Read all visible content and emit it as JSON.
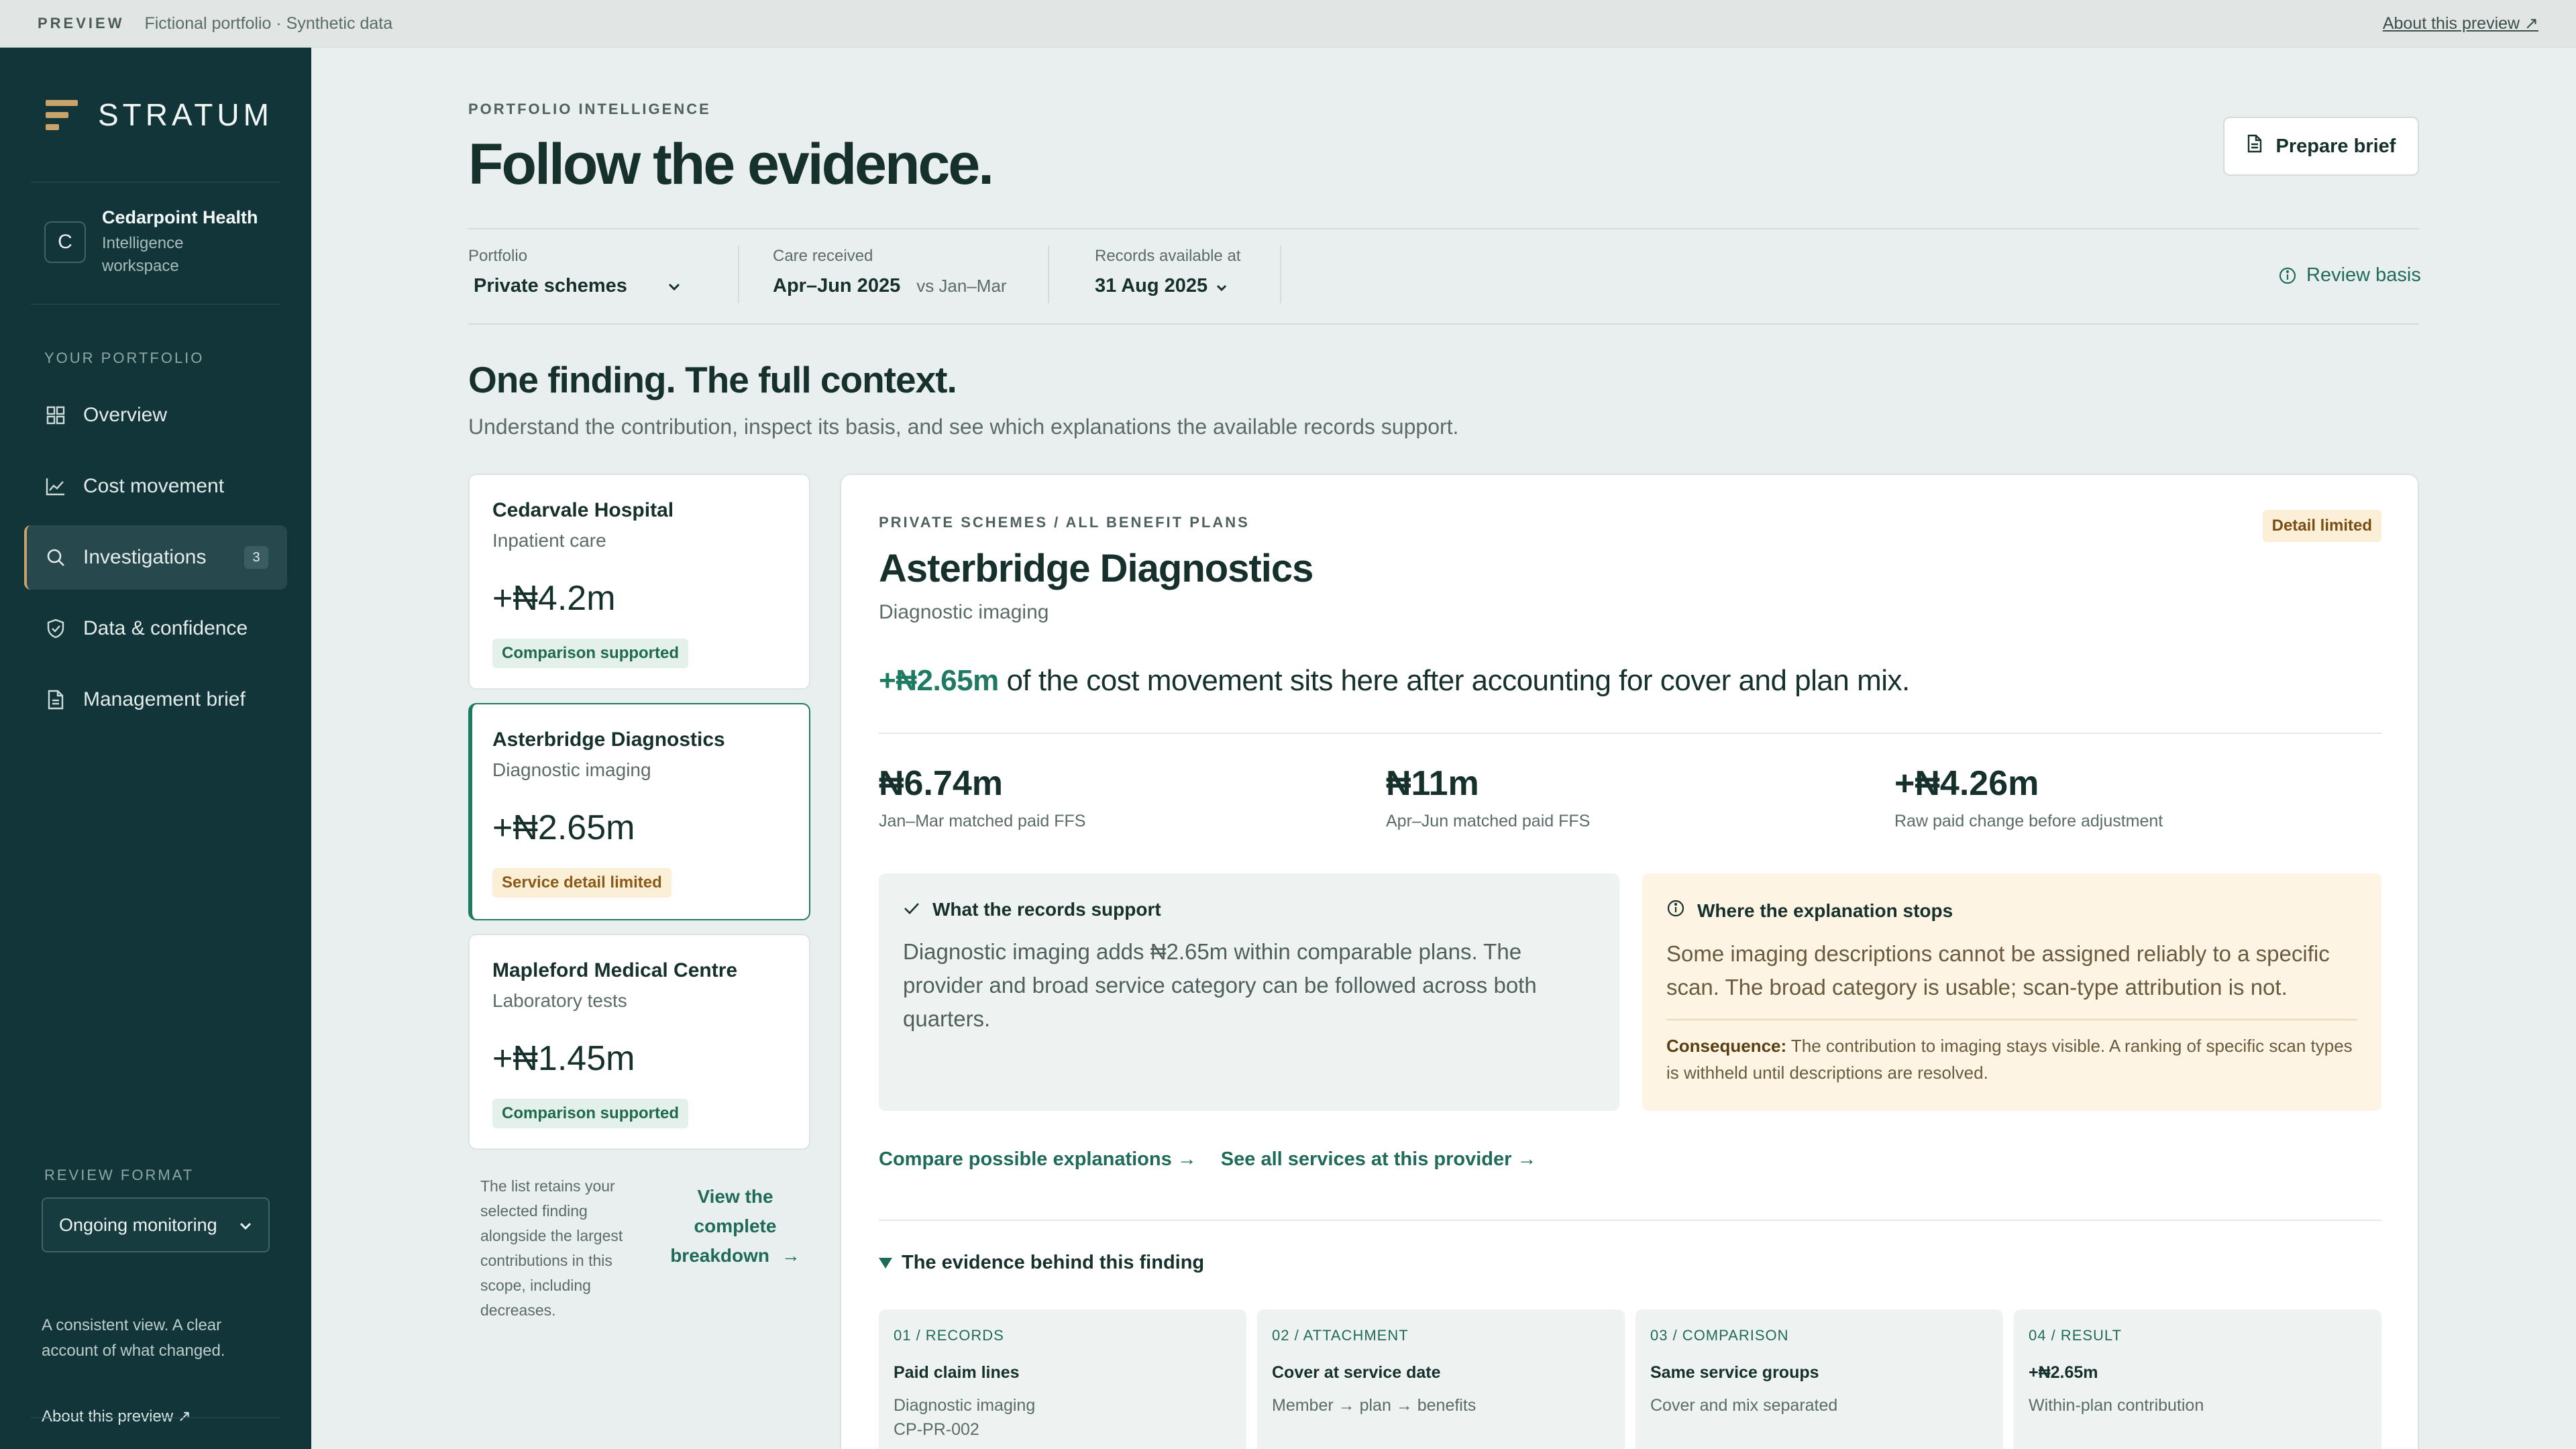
{
  "preview_bar": {
    "tag": "PREVIEW",
    "text": "Fictional portfolio · Synthetic data",
    "about_link": "About this preview ↗"
  },
  "sidebar": {
    "brand": "STRATUM",
    "org": {
      "initial": "C",
      "name": "Cedarpoint Health",
      "subtitle_line1": "Intelligence",
      "subtitle_line2": "workspace"
    },
    "section_label": "YOUR PORTFOLIO",
    "nav": [
      {
        "label": "Overview",
        "icon": "grid-icon"
      },
      {
        "label": "Cost movement",
        "icon": "line-chart-icon"
      },
      {
        "label": "Investigations",
        "icon": "search-icon",
        "badge": "3",
        "active": true
      },
      {
        "label": "Data & confidence",
        "icon": "shield-check-icon"
      },
      {
        "label": "Management brief",
        "icon": "document-icon"
      }
    ],
    "review_format_label": "REVIEW FORMAT",
    "review_format_value": "Ongoing monitoring",
    "note": "A consistent view. A clear account of what changed.",
    "about": "About this preview ↗"
  },
  "header": {
    "eyebrow": "PORTFOLIO INTELLIGENCE",
    "title": "Follow the evidence.",
    "prepare_button": "Prepare brief"
  },
  "filters": {
    "portfolio": {
      "label": "Portfolio",
      "value": "Private schemes"
    },
    "care": {
      "label": "Care received",
      "value": "Apr–Jun 2025",
      "compare": "vs Jan–Mar"
    },
    "records": {
      "label": "Records available at",
      "value": "31 Aug 2025"
    },
    "review_basis": "Review basis"
  },
  "section": {
    "title": "One finding. The full context.",
    "lead": "Understand the contribution, inspect its basis, and see which explanations the available records support."
  },
  "findings": [
    {
      "provider": "Cedarvale Hospital",
      "category": "Inpatient care",
      "amount": "+₦4.2m",
      "status": "Comparison supported",
      "tone": "green"
    },
    {
      "provider": "Asterbridge Diagnostics",
      "category": "Diagnostic imaging",
      "amount": "+₦2.65m",
      "status": "Service detail limited",
      "tone": "amber",
      "selected": true
    },
    {
      "provider": "Mapleford Medical Centre",
      "category": "Laboratory tests",
      "amount": "+₦1.45m",
      "status": "Comparison supported",
      "tone": "green"
    }
  ],
  "list_note": "The list retains your selected finding alongside the largest contributions in this scope, including decreases.",
  "view_breakdown": "View the complete breakdown",
  "detail": {
    "eyebrow": "PRIVATE SCHEMES / ALL BENEFIT PLANS",
    "badge": "Detail limited",
    "title": "Asterbridge Diagnostics",
    "subtitle": "Diagnostic imaging",
    "statement_amount": "+₦2.65m",
    "statement_rest": " of the cost movement sits here after accounting for cover and plan mix.",
    "metrics": [
      {
        "value": "₦6.74m",
        "label": "Jan–Mar matched paid FFS"
      },
      {
        "value": "₦11m",
        "label": "Apr–Jun matched paid FFS"
      },
      {
        "value": "+₦4.26m",
        "label": "Raw paid change before adjustment"
      }
    ],
    "support": {
      "heading": "What the records support",
      "body": "Diagnostic imaging adds ₦2.65m within comparable plans. The provider and broad service category can be followed across both quarters."
    },
    "stop": {
      "heading": "Where the explanation stops",
      "body": "Some imaging descriptions cannot be assigned reliably to a specific scan. The broad category is usable; scan-type attribution is not.",
      "consequence_label": "Consequence:",
      "consequence": " The contribution to imaging stays visible. A ranking of specific scan types is withheld until descriptions are resolved."
    },
    "links": [
      "Compare possible explanations →",
      "See all services at this provider →"
    ],
    "evidence_title": "The evidence behind this finding",
    "steps": [
      {
        "key": "01 / RECORDS",
        "title": "Paid claim lines",
        "desc1": "Diagnostic imaging",
        "desc2": "CP-PR-002"
      },
      {
        "key": "02 / ATTACHMENT",
        "title": "Cover at service date",
        "desc1": "Member → plan → benefits",
        "desc2": ""
      },
      {
        "key": "03 / COMPARISON",
        "title": "Same service groups",
        "desc1": "Cover and mix separated",
        "desc2": ""
      },
      {
        "key": "04 / RESULT",
        "title": "+₦2.65m",
        "desc1": "Within-plan contribution",
        "desc2": ""
      }
    ]
  },
  "colors": {
    "sidebar_bg": "#123539",
    "accent_green": "#1e7a63",
    "accent_gold": "#c9a36a",
    "amber_bg": "#fcefd8"
  }
}
